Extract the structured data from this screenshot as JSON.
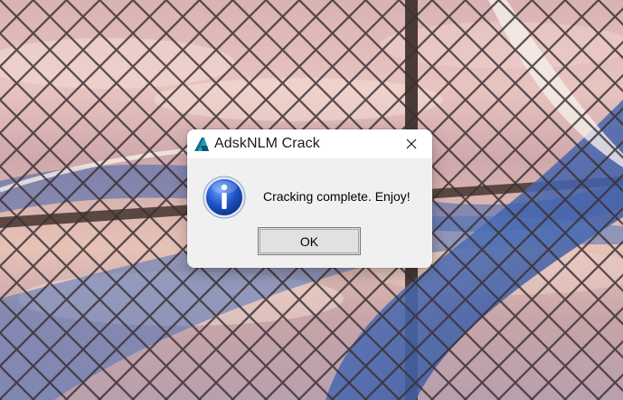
{
  "window": {
    "title": "AdskNLM Crack",
    "app_icon": "autodesk-logo-icon",
    "close_icon": "close-icon"
  },
  "message": {
    "icon": "info-icon",
    "text": "Cracking complete. Enjoy!"
  },
  "buttons": {
    "ok_label": "OK"
  },
  "colors": {
    "titlebar": "#ffffff",
    "dialog_bg": "#f0f0f0",
    "info_icon_blue": "#1f56c9",
    "logo_teal": "#1fa0b8"
  }
}
